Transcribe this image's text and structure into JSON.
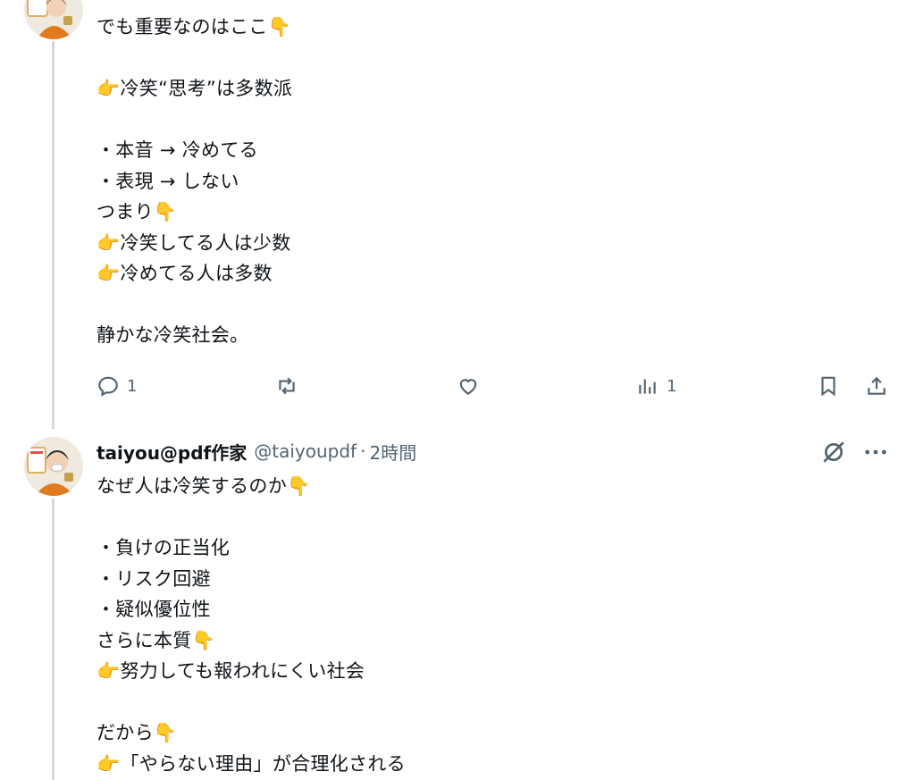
{
  "posts": [
    {
      "body": "でも重要なのはここ👇\n\n👉冷笑“思考”は多数派\n\n・本音 → 冷めてる\n・表現 → しない\nつまり👇\n👉冷笑してる人は少数\n👉冷めてる人は多数\n\n静かな冷笑社会。",
      "actions": {
        "reply_count": "1",
        "repost_count": "",
        "like_count": "",
        "views_count": "1"
      }
    },
    {
      "display_name": "taiyou@pdf作家",
      "handle": "@taiyoupdf",
      "separator": "·",
      "time": "2時間",
      "body": "なぜ人は冷笑するのか👇\n\n・負けの正当化\n・リスク回避\n・疑似優位性\nさらに本質👇\n👉努力しても報われにくい社会\n\nだから👇\n👉「やらない理由」が合理化される"
    }
  ],
  "icons": {
    "reply": "reply-icon",
    "repost": "repost-icon",
    "like": "like-icon",
    "views": "views-icon",
    "bookmark": "bookmark-icon",
    "share": "share-icon",
    "grok": "grok-icon",
    "more": "more-icon"
  },
  "colors": {
    "text": "#0f1419",
    "muted": "#536471",
    "thread_line": "#cfd9de"
  }
}
